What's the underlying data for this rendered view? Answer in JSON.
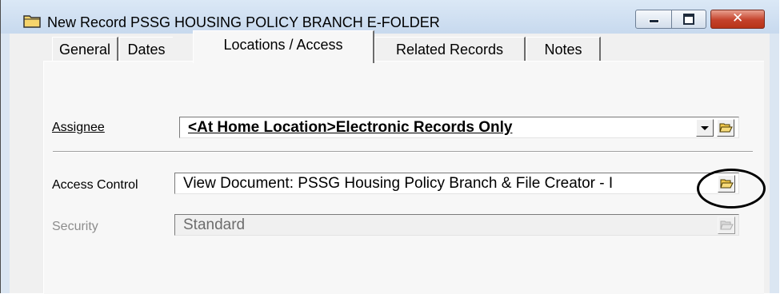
{
  "window": {
    "title": "New Record PSSG HOUSING POLICY BRANCH E-FOLDER",
    "icon": "folder-icon",
    "controls": {
      "minimize": "minimize-icon",
      "maximize": "maximize-icon",
      "close": "✕"
    }
  },
  "tabs": [
    {
      "label": "General",
      "active": false
    },
    {
      "label": "Dates",
      "active": false
    },
    {
      "label": "Locations / Access",
      "active": true
    },
    {
      "label": "Related Records",
      "active": false
    },
    {
      "label": "Notes",
      "active": false
    }
  ],
  "form": {
    "assignee": {
      "label": "Assignee",
      "value": "<At Home Location>Electronic Records Only"
    },
    "access_control": {
      "label": "Access Control",
      "value": "View Document: PSSG Housing Policy Branch & File Creator - I"
    },
    "security": {
      "label": "Security",
      "value": "Standard"
    }
  },
  "colors": {
    "accent_close": "#c4412a",
    "panel_bg": "#f7f7f7",
    "titlebar_bg": "#c7d9ee",
    "folder_yellow": "#f2c94c"
  }
}
